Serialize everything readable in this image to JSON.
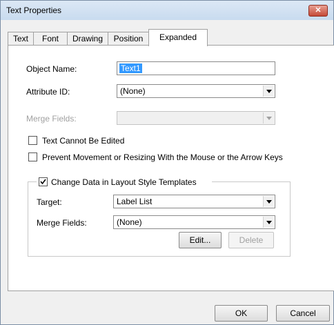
{
  "window": {
    "title": "Text Properties",
    "close_label": "✕"
  },
  "tabs": [
    {
      "label": "Text"
    },
    {
      "label": "Font"
    },
    {
      "label": "Drawing"
    },
    {
      "label": "Position"
    },
    {
      "label": "Expanded"
    }
  ],
  "form": {
    "object_name_label": "Object Name:",
    "object_name_value": "Text1",
    "attribute_id_label": "Attribute ID:",
    "attribute_id_value": "(None)",
    "merge_fields_label": "Merge Fields:",
    "merge_fields_value": "",
    "text_cannot_be_edited_label": "Text Cannot Be Edited",
    "text_cannot_be_edited_checked": false,
    "prevent_movement_label": "Prevent Movement or Resizing With the Mouse or the Arrow Keys",
    "prevent_movement_checked": false
  },
  "group": {
    "title": "Change Data in Layout Style Templates",
    "checked": true,
    "target_label": "Target:",
    "target_value": "Label List",
    "merge_fields_label": "Merge Fields:",
    "merge_fields_value": "(None)",
    "edit_label": "Edit...",
    "delete_label": "Delete"
  },
  "buttons": {
    "ok_label": "OK",
    "cancel_label": "Cancel"
  }
}
